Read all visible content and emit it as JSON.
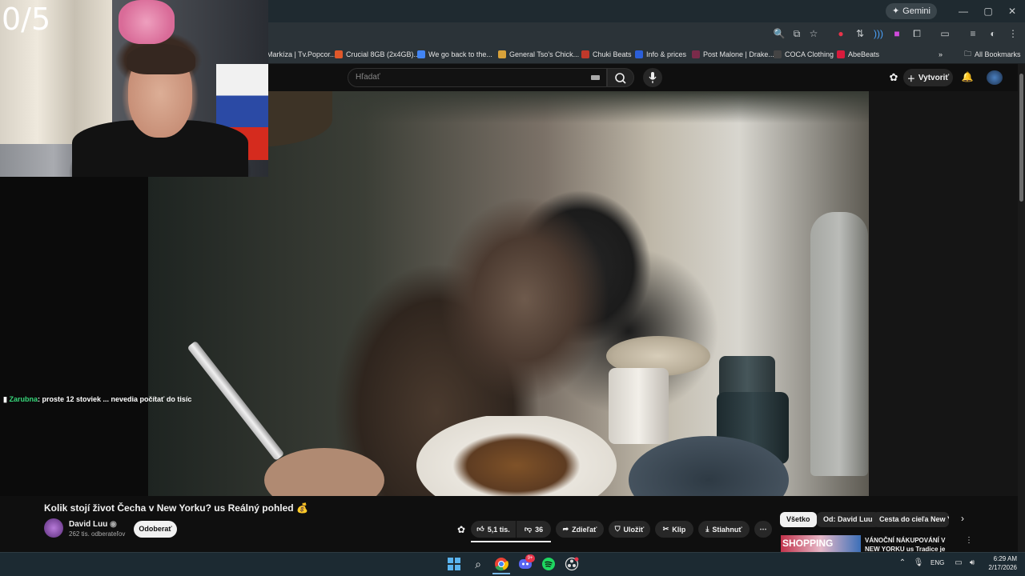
{
  "overlay": {
    "counter": "0/5"
  },
  "browser": {
    "gemini_label": "Gemini",
    "bookmarks": [
      {
        "label": "Markíza | Tv.Popcor...",
        "color": "#3a6bd6"
      },
      {
        "label": "Crucial 8GB (2x4GB)...",
        "color": "#e0582a"
      },
      {
        "label": "We go back to the...",
        "color": "#4285f4"
      },
      {
        "label": "General Tso's Chick...",
        "color": "#d8a23a"
      },
      {
        "label": "Chuki Beats",
        "color": "#c0392b"
      },
      {
        "label": "Info & prices",
        "color": "#2b5fd9"
      },
      {
        "label": "Post Malone | Drake...",
        "color": "#7a2b4a"
      },
      {
        "label": "COCA Clothing",
        "color": "#222222"
      },
      {
        "label": "AbeBeats",
        "color": "#d81b3c"
      }
    ],
    "all_bookmarks": "All Bookmarks"
  },
  "youtube": {
    "search_placeholder": "Hľadať",
    "create_label": "Vytvoriť",
    "chat": {
      "user": "Zarubna",
      "message": ": proste 12 stoviek ... nevedia počítať do tisíc"
    },
    "video": {
      "title": "Kolik stojí život Čecha v New Yorku? us Reálný pohled 💰",
      "channel": "David Luu",
      "subscribers": "262 tis. odberateľov",
      "subscribe_label": "Odoberať",
      "likes": "5,1 tis.",
      "dislikes": "36",
      "share_label": "Zdieľať",
      "save_label": "Uložiť",
      "clip_label": "Klip",
      "download_label": "Stiahnuť"
    },
    "chips": [
      "Všetko",
      "Od: David Luu",
      "Cesta do cieľa New Yo"
    ],
    "recommendation": {
      "thumb_text": "SHOPPING",
      "title": "VÁNOČNÍ NÁKUPOVÁNÍ V NEW YORKU us Tradice je tradice"
    }
  },
  "taskbar": {
    "language": "ENG",
    "time": "6:29 AM",
    "date": "2/17/2026",
    "discord_badge": "9+"
  }
}
